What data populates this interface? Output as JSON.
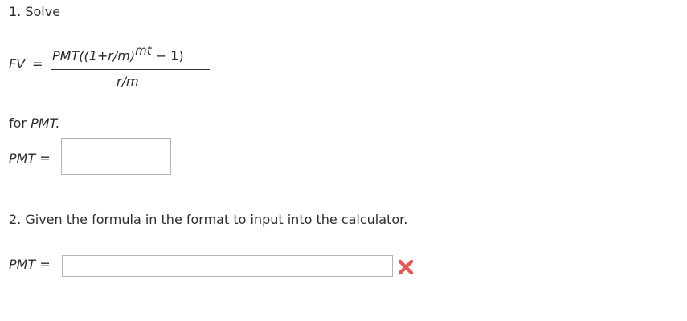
{
  "question1": {
    "title": "1. Solve",
    "lhs_var": "FV",
    "equals": "=",
    "numerator_main": "PMT((1+r/m)",
    "numerator_exponent": "mt",
    "numerator_tail": " − 1)",
    "denominator": "r/m",
    "solve_for_prefix": "for ",
    "solve_for_var": "PMT.",
    "answer_label": "PMT",
    "answer_value": ""
  },
  "question2": {
    "title": "2. Given the formula in the format to input into the calculator.",
    "answer_label": "PMT",
    "equals": "=",
    "answer_value": "",
    "status_icon": "incorrect-x-icon",
    "status_color": "#e05a5a"
  }
}
